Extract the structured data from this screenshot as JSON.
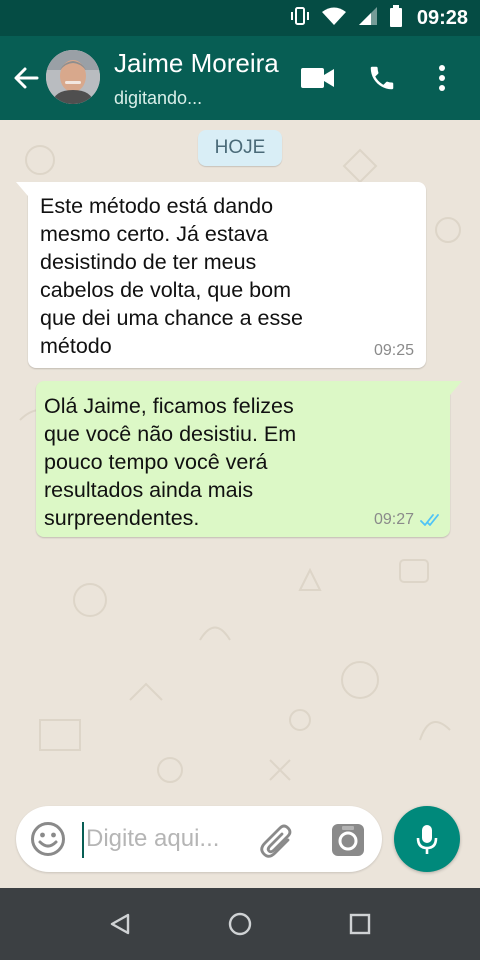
{
  "status_bar": {
    "time": "09:28",
    "icons": [
      "vibrate-icon",
      "wifi-icon",
      "signal-icon",
      "battery-icon"
    ]
  },
  "header": {
    "contact_name": "Jaime Moreira",
    "contact_status": "digitando...",
    "actions": [
      "video-call-icon",
      "phone-icon",
      "more-options-icon"
    ],
    "colors": {
      "header": "#075e54",
      "status_bar": "#054c44"
    }
  },
  "chat": {
    "date_chip": "HOJE",
    "messages": [
      {
        "direction": "incoming",
        "text": "Este método está dando\nmesmo certo. Já estava\ndesistindo de ter meus\ncabelos de volta, que bom\nque dei uma chance a esse\nmétodo",
        "time": "09:25"
      },
      {
        "direction": "outgoing",
        "text": "Olá Jaime, ficamos felizes\nque você não desistiu. Em\npouco tempo você verá\nresultados ainda mais\nsurpreendentes.",
        "time": "09:27",
        "status": "read-ticks-icon"
      }
    ],
    "colors": {
      "incoming": "#ffffff",
      "outgoing": "#dcf8c6",
      "ticks": "#4fc3f7"
    }
  },
  "composer": {
    "placeholder": "Digite aqui...",
    "value": "",
    "buttons": [
      "emoji-icon",
      "attach-icon",
      "camera-icon",
      "mic-icon"
    ],
    "mic_color": "#00897b"
  },
  "nav_bar": {
    "buttons": [
      "back-triangle-icon",
      "home-circle-icon",
      "recents-square-icon"
    ]
  }
}
